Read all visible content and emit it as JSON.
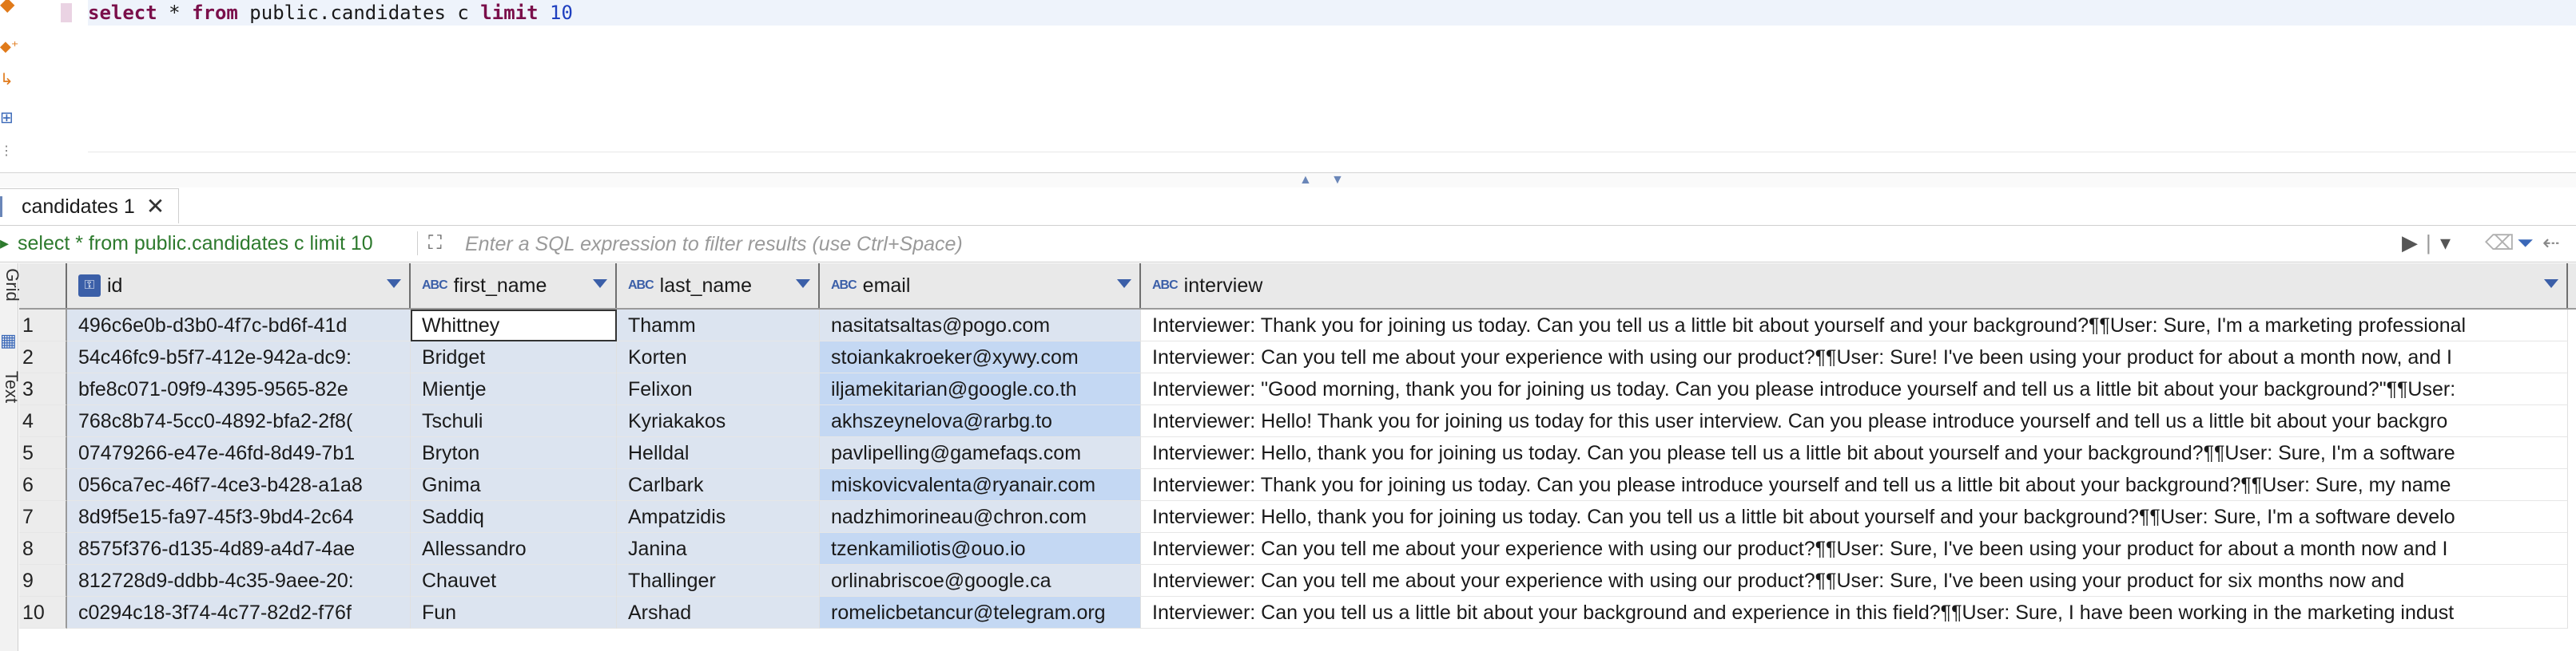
{
  "editor": {
    "line_marker_color": "#ead3e3",
    "query_tokens": [
      {
        "text": "select",
        "kind": "kw"
      },
      {
        "text": " * ",
        "kind": "plain"
      },
      {
        "text": "from",
        "kind": "kw"
      },
      {
        "text": " public.candidates c ",
        "kind": "plain"
      },
      {
        "text": "limit",
        "kind": "kw"
      },
      {
        "text": " ",
        "kind": "plain"
      },
      {
        "text": "10",
        "kind": "num"
      }
    ],
    "gutter_icons": [
      "execute-icon",
      "execute-script-icon",
      "explain-plan-icon",
      "load-plan-icon",
      "more-icon"
    ]
  },
  "results": {
    "tab_label": "candidates 1",
    "tab_close": "✕"
  },
  "filter": {
    "query_text": "select * from public.candidates c limit 10",
    "placeholder": "Enter a SQL expression to filter results (use Ctrl+Space)"
  },
  "side_panel": {
    "tabs": [
      "Grid",
      "Text"
    ]
  },
  "grid": {
    "columns": [
      {
        "name": "id",
        "type": "key"
      },
      {
        "name": "first_name",
        "type": "ABC"
      },
      {
        "name": "last_name",
        "type": "ABC"
      },
      {
        "name": "email",
        "type": "ABC"
      },
      {
        "name": "interview",
        "type": "ABC"
      }
    ],
    "rows": [
      {
        "n": "1",
        "id": "496c6e0b-d3b0-4f7c-bd6f-41d",
        "first_name": "Whittney",
        "last_name": "Thamm",
        "email": "nasitatsaltas@pogo.com",
        "interview": "Interviewer: Thank you for joining us today. Can you tell us a little bit about yourself and your background?¶¶User: Sure, I'm a marketing professional"
      },
      {
        "n": "2",
        "id": "54c46fc9-b5f7-412e-942a-dc9:",
        "first_name": "Bridget",
        "last_name": "Korten",
        "email": "stoiankakroeker@xywy.com",
        "interview": "Interviewer: Can you tell me about your experience with using our product?¶¶User: Sure! I've been using your product for about a month now, and I"
      },
      {
        "n": "3",
        "id": "bfe8c071-09f9-4395-9565-82e",
        "first_name": "Mientje",
        "last_name": "Felixon",
        "email": "iljamekitarian@google.co.th",
        "interview": "Interviewer: \"Good morning, thank you for joining us today. Can you please introduce yourself and tell us a little bit about your background?\"¶¶User:"
      },
      {
        "n": "4",
        "id": "768c8b74-5cc0-4892-bfa2-2f8(",
        "first_name": "Tschuli",
        "last_name": "Kyriakakos",
        "email": "akhszeynelova@rarbg.to",
        "interview": "Interviewer: Hello! Thank you for joining us today for this user interview. Can you please introduce yourself and tell us a little bit about your backgro"
      },
      {
        "n": "5",
        "id": "07479266-e47e-46fd-8d49-7b1",
        "first_name": "Bryton",
        "last_name": "Helldal",
        "email": "pavlipelling@gamefaqs.com",
        "interview": "Interviewer: Hello, thank you for joining us today. Can you please tell us a little bit about yourself and your background?¶¶User: Sure, I'm a software"
      },
      {
        "n": "6",
        "id": "056ca7ec-46f7-4ce3-b428-a1a8",
        "first_name": "Gnima",
        "last_name": "Carlbark",
        "email": "miskovicvalenta@ryanair.com",
        "interview": "Interviewer: Thank you for joining us today. Can you please introduce yourself and tell us a little bit about your background?¶¶User: Sure, my name"
      },
      {
        "n": "7",
        "id": "8d9f5e15-fa97-45f3-9bd4-2c64",
        "first_name": "Saddiq",
        "last_name": "Ampatzidis",
        "email": "nadzhimorineau@chron.com",
        "interview": "Interviewer: Hello, thank you for joining us today. Can you tell us a little bit about yourself and your background?¶¶User: Sure, I'm a software develo"
      },
      {
        "n": "8",
        "id": "8575f376-d135-4d89-a4d7-4ae",
        "first_name": "Allessandro",
        "last_name": "Janina",
        "email": "tzenkamiliotis@ouo.io",
        "interview": "Interviewer: Can you tell me about your experience with using our product?¶¶User: Sure, I've been using your product for about a month now and I"
      },
      {
        "n": "9",
        "id": "812728d9-ddbb-4c35-9aee-20:",
        "first_name": "Chauvet",
        "last_name": "Thallinger",
        "email": "orlinabriscoe@google.ca",
        "interview": "Interviewer: Can you tell me about your experience with using our product?¶¶User: Sure, I've been using your product for six months now and"
      },
      {
        "n": "10",
        "id": "c0294c18-3f74-4c77-82d2-f76f",
        "first_name": "Fun",
        "last_name": "Arshad",
        "email": "romelicbetancur@telegram.org",
        "interview": "Interviewer: Can you tell us a little bit about your background and experience in this field?¶¶User: Sure, I have been working in the marketing indust"
      }
    ],
    "selected_cell": {
      "row": 1,
      "column": "first_name"
    },
    "highlighted_email_rows": [
      2,
      3,
      4,
      6,
      8,
      10
    ]
  },
  "colors": {
    "keyword": "#7a0f4a",
    "number": "#1f3fbf",
    "filter_query": "#2d7a2d",
    "header_accent": "#3b5fa8",
    "cell_bg": "#dce4f0",
    "email_highlight": "#c4d8f3"
  }
}
